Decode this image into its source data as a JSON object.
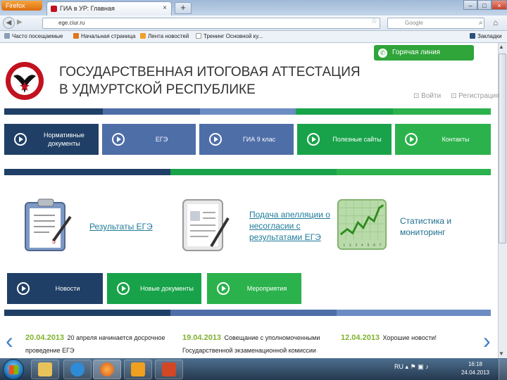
{
  "browser": {
    "app_button": "Firefox",
    "tab_title": "ГИА в УР: Главная",
    "tab_close": "×",
    "new_tab": "+",
    "window_buttons": [
      "–",
      "□",
      "×"
    ],
    "url": "ege.ciur.ru",
    "search_placeholder": "Google",
    "bookmarks": [
      "Часто посещаемые",
      "Начальная страница",
      "Лента новостей",
      "Тренинг Основной ку..."
    ],
    "bookmarks_menu": "Закладки"
  },
  "page": {
    "hotline": "Горячая линия",
    "title_line1": "ГОСУДАРСТВЕННАЯ ИТОГОВАЯ АТТЕСТАЦИЯ",
    "title_line2": "В УДМУРТСКОЙ РЕСПУБЛИКЕ",
    "login": "Войти",
    "register": "Регистрация",
    "nav_top": [
      {
        "label": "Нормативные документы",
        "color": "#1f3f66"
      },
      {
        "label": "ЕГЭ",
        "color": "#4e6ea8"
      },
      {
        "label": "ГИА 9 клас",
        "color": "#4e6ea8"
      },
      {
        "label": "Полезные сайты",
        "color": "#18a34a"
      },
      {
        "label": "Контакты",
        "color": "#2bb24c"
      }
    ],
    "services": [
      {
        "label": "Результаты ЕГЭ"
      },
      {
        "label": "Подача апелляции о несогласии с результатами ЕГЭ"
      },
      {
        "label": "Статистика и мониторинг"
      }
    ],
    "chart_axis": [
      "1",
      "2",
      "3",
      "4",
      "5",
      "6",
      "7"
    ],
    "nav_bottom": [
      {
        "label": "Новости",
        "color": "#1f3f66"
      },
      {
        "label": "Новые документы",
        "color": "#18a34a"
      },
      {
        "label": "Мероприятия",
        "color": "#2bb24c"
      }
    ],
    "news": [
      {
        "date": "20.04.2013",
        "text": "20 апреля начинается досрочное проведение ЕГЭ"
      },
      {
        "date": "19.04.2013",
        "text": "Совещание с уполномоченными Государственной экзаменационной комиссии"
      },
      {
        "date": "12.04.2013",
        "text": "Хорошие новости!"
      }
    ]
  },
  "taskbar": {
    "lang": "RU",
    "time": "16:18",
    "date": "24.04.2013"
  }
}
